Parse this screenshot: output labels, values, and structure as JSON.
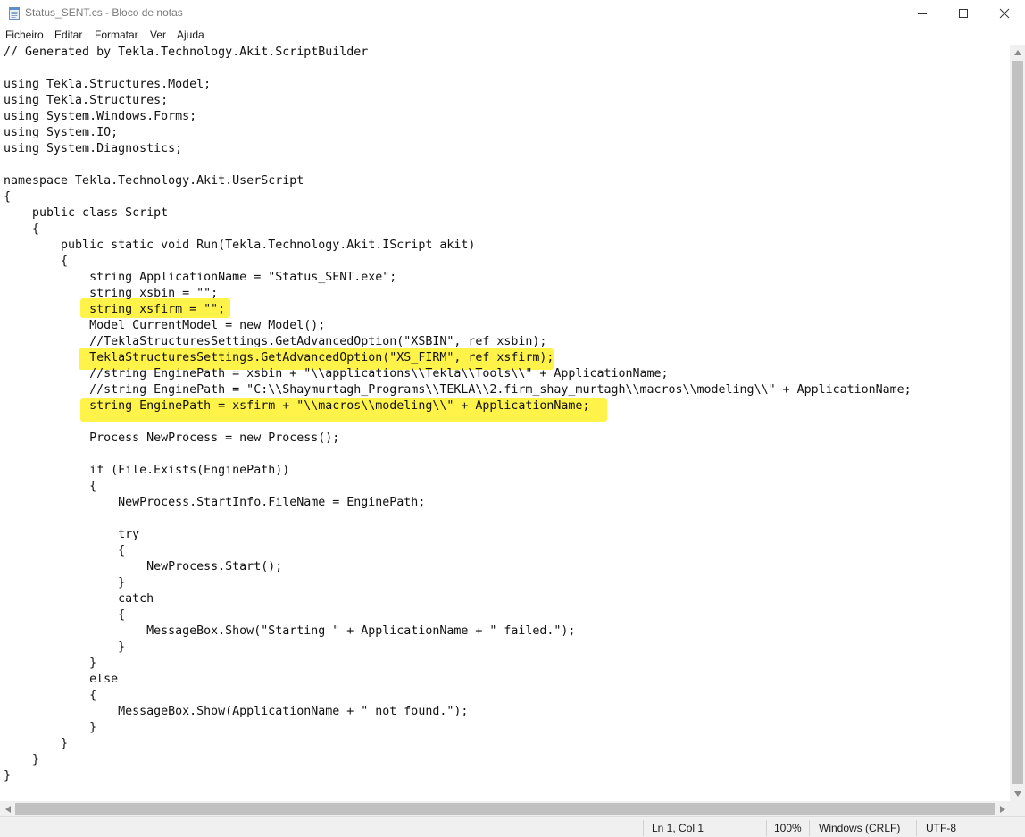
{
  "window": {
    "title": "Status_SENT.cs - Bloco de notas",
    "icon": "notepad-icon",
    "controls": [
      "minimize-icon",
      "maximize-icon",
      "close-icon"
    ]
  },
  "menu": {
    "items": [
      "Ficheiro",
      "Editar",
      "Formatar",
      "Ver",
      "Ajuda"
    ]
  },
  "editor": {
    "highlight_color": "#fff34a",
    "lines": [
      "// Generated by Tekla.Technology.Akit.ScriptBuilder",
      "",
      "using Tekla.Structures.Model;",
      "using Tekla.Structures;",
      "using System.Windows.Forms;",
      "using System.IO;",
      "using System.Diagnostics;",
      "",
      "namespace Tekla.Technology.Akit.UserScript",
      "{",
      "    public class Script",
      "    {",
      "        public static void Run(Tekla.Technology.Akit.IScript akit)",
      "        {",
      "            string ApplicationName = \"Status_SENT.exe\";",
      "            string xsbin = \"\";",
      "            string xsfirm = \"\";",
      "            Model CurrentModel = new Model();",
      "            //TeklaStructuresSettings.GetAdvancedOption(\"XSBIN\", ref xsbin);",
      "            TeklaStructuresSettings.GetAdvancedOption(\"XS_FIRM\", ref xsfirm);",
      "            //string EnginePath = xsbin + \"\\\\applications\\\\Tekla\\\\Tools\\\\\" + ApplicationName;",
      "            //string EnginePath = \"C:\\\\Shaymurtagh_Programs\\\\TEKLA\\\\2.firm_shay_murtagh\\\\macros\\\\modeling\\\\\" + ApplicationName;",
      "            string EnginePath = xsfirm + \"\\\\macros\\\\modeling\\\\\" + ApplicationName;",
      "",
      "            Process NewProcess = new Process();",
      "",
      "            if (File.Exists(EnginePath))",
      "            {",
      "                NewProcess.StartInfo.FileName = EnginePath;",
      "",
      "                try",
      "                {",
      "                    NewProcess.Start();",
      "                }",
      "                catch",
      "                {",
      "                    MessageBox.Show(\"Starting \" + ApplicationName + \" failed.\");",
      "                }",
      "            }",
      "            else",
      "            {",
      "                MessageBox.Show(ApplicationName + \" not found.\");",
      "            }",
      "        }",
      "    }",
      "}"
    ]
  },
  "status": {
    "position": "Ln 1, Col 1",
    "zoom": "100%",
    "line_ending": "Windows (CRLF)",
    "encoding": "UTF-8"
  }
}
